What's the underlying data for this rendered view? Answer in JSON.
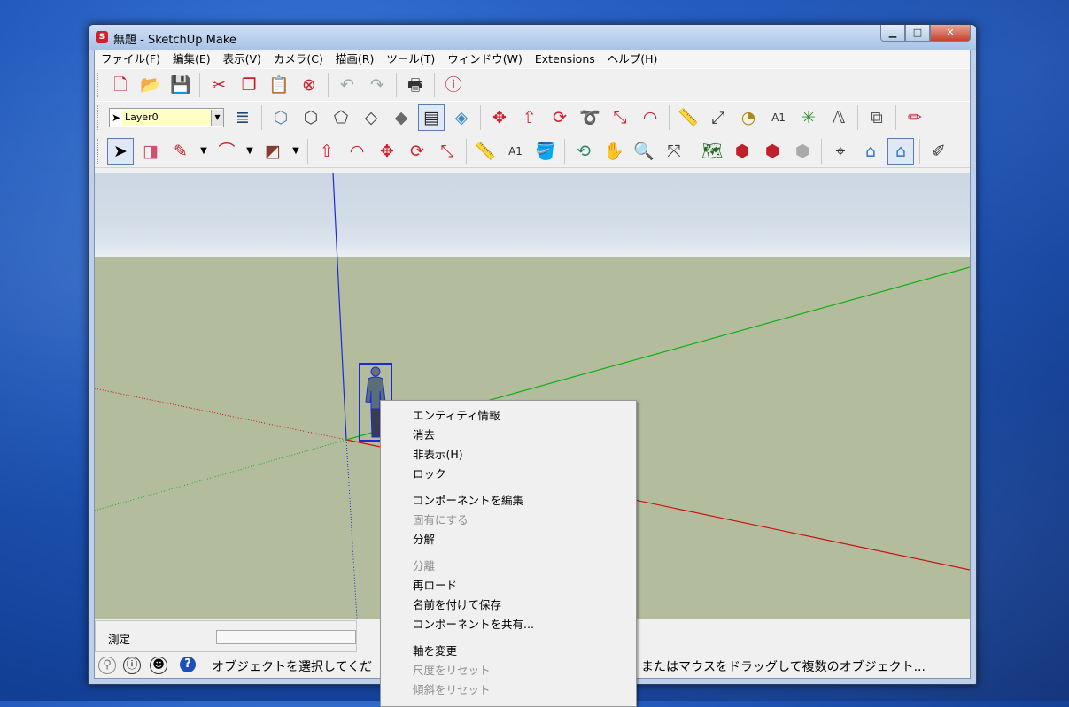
{
  "window": {
    "title": "無題 - SketchUp Make",
    "app_icon": "sketchup-logo-icon"
  },
  "menubar": [
    "ファイル(F)",
    "編集(E)",
    "表示(V)",
    "カメラ(C)",
    "描画(R)",
    "ツール(T)",
    "ウィンドウ(W)",
    "Extensions",
    "ヘルプ(H)"
  ],
  "layer": {
    "name": "Layer0"
  },
  "measure": {
    "label": "測定",
    "value": ""
  },
  "status": {
    "text_left": "オブジェクトを選択してくだ",
    "text_right": "またはマウスをドラッグして複数のオブジェクト..."
  },
  "context_menu": [
    {
      "label": "エンティティ情報",
      "enabled": true
    },
    {
      "label": "消去",
      "enabled": true
    },
    {
      "label": "非表示(H)",
      "enabled": true
    },
    {
      "label": "ロック",
      "enabled": true
    },
    {
      "label": "コンポーネントを編集",
      "enabled": true
    },
    {
      "label": "固有にする",
      "enabled": false
    },
    {
      "label": "分解",
      "enabled": true
    },
    {
      "label": "分離",
      "enabled": false
    },
    {
      "label": "再ロード",
      "enabled": true
    },
    {
      "label": "名前を付けて保存",
      "enabled": true
    },
    {
      "label": "コンポーネントを共有...",
      "enabled": true
    },
    {
      "label": "軸を変更",
      "enabled": true
    },
    {
      "label": "尺度をリセット",
      "enabled": false
    },
    {
      "label": "傾斜をリセット",
      "enabled": false
    }
  ],
  "colors": {
    "axis_red": "#cc1010",
    "axis_green": "#10b010",
    "axis_blue": "#1a2bd8",
    "ground": "#b3bd9e",
    "sky": "#d3dde8",
    "selection": "#1a2bd8"
  }
}
